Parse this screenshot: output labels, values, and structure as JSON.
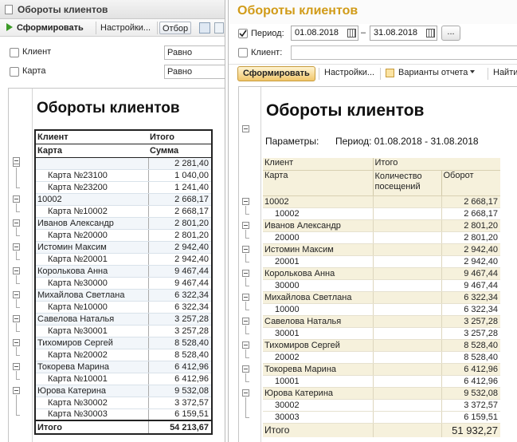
{
  "left": {
    "window_title": "Обороты клиентов",
    "toolbar": {
      "generate_label": "Сформировать",
      "settings_label": "Настройки...",
      "filter_label": "Отбор"
    },
    "filters": [
      {
        "label": "Клиент",
        "value": "Равно"
      },
      {
        "label": "Карта",
        "value": "Равно"
      }
    ],
    "report": {
      "title": "Обороты клиентов",
      "col_headers_1": [
        "Клиент",
        "Итого"
      ],
      "col_headers_2": [
        "Карта",
        "Сумма"
      ],
      "rows": [
        {
          "kind": "g",
          "name": "",
          "value": "2 281,40"
        },
        {
          "kind": "d",
          "name": "Карта №23100",
          "value": "1 040,00"
        },
        {
          "kind": "d",
          "name": "Карта №23200",
          "value": "1 241,40"
        },
        {
          "kind": "g",
          "name": "10002",
          "value": "2 668,17"
        },
        {
          "kind": "d",
          "name": "Карта №10002",
          "value": "2 668,17"
        },
        {
          "kind": "g",
          "name": "Иванов Александр",
          "value": "2 801,20"
        },
        {
          "kind": "d",
          "name": "Карта №20000",
          "value": "2 801,20"
        },
        {
          "kind": "g",
          "name": "Истомин Максим",
          "value": "2 942,40"
        },
        {
          "kind": "d",
          "name": "Карта №20001",
          "value": "2 942,40"
        },
        {
          "kind": "g",
          "name": "Королькова Анна",
          "value": "9 467,44"
        },
        {
          "kind": "d",
          "name": "Карта №30000",
          "value": "9 467,44"
        },
        {
          "kind": "g",
          "name": "Михайлова Светлана",
          "value": "6 322,34"
        },
        {
          "kind": "d",
          "name": "Карта №10000",
          "value": "6 322,34"
        },
        {
          "kind": "g",
          "name": "Савелова Наталья",
          "value": "3 257,28"
        },
        {
          "kind": "d",
          "name": "Карта №30001",
          "value": "3 257,28"
        },
        {
          "kind": "g",
          "name": "Тихомиров Сергей",
          "value": "8 528,40"
        },
        {
          "kind": "d",
          "name": "Карта №20002",
          "value": "8 528,40"
        },
        {
          "kind": "g",
          "name": "Токорева Марина",
          "value": "6 412,96"
        },
        {
          "kind": "d",
          "name": "Карта №10001",
          "value": "6 412,96"
        },
        {
          "kind": "g",
          "name": "Юрова Катерина",
          "value": "9 532,08"
        },
        {
          "kind": "d",
          "name": "Карта №30002",
          "value": "3 372,57"
        },
        {
          "kind": "d",
          "name": "Карта №30003",
          "value": "6 159,51"
        }
      ],
      "total": {
        "label": "Итого",
        "value": "54 213,67"
      }
    }
  },
  "right": {
    "title": "Обороты клиентов",
    "period": {
      "checked": true,
      "label": "Период:",
      "from": "01.08.2018",
      "separator": "–",
      "to": "31.08.2018",
      "more_label": "..."
    },
    "client_filter": {
      "checked": false,
      "label": "Клиент:",
      "value": ""
    },
    "toolbar": {
      "generate_label": "Сформировать",
      "settings_label": "Настройки...",
      "variants_label": "Варианты отчета",
      "find_label": "Найти..."
    },
    "report": {
      "title": "Обороты клиентов",
      "params_label": "Параметры:",
      "params_text": "Период: 01.08.2018 - 31.08.2018",
      "headers": {
        "client": "Клиент",
        "total": "Итого",
        "card": "Карта",
        "visits_line1": "Количество",
        "visits_line2": "посещений",
        "turnover": "Оборот"
      },
      "rows": [
        {
          "kind": "g",
          "name": "10002",
          "value": "2 668,17"
        },
        {
          "kind": "d",
          "name": "10002",
          "value": "2 668,17"
        },
        {
          "kind": "g",
          "name": "Иванов Александр",
          "value": "2 801,20"
        },
        {
          "kind": "d",
          "name": "20000",
          "value": "2 801,20"
        },
        {
          "kind": "g",
          "name": "Истомин Максим",
          "value": "2 942,40"
        },
        {
          "kind": "d",
          "name": "20001",
          "value": "2 942,40"
        },
        {
          "kind": "g",
          "name": "Королькова Анна",
          "value": "9 467,44"
        },
        {
          "kind": "d",
          "name": "30000",
          "value": "9 467,44"
        },
        {
          "kind": "g",
          "name": "Михайлова Светлана",
          "value": "6 322,34"
        },
        {
          "kind": "d",
          "name": "10000",
          "value": "6 322,34"
        },
        {
          "kind": "g",
          "name": "Савелова Наталья",
          "value": "3 257,28"
        },
        {
          "kind": "d",
          "name": "30001",
          "value": "3 257,28"
        },
        {
          "kind": "g",
          "name": "Тихомиров Сергей",
          "value": "8 528,40"
        },
        {
          "kind": "d",
          "name": "20002",
          "value": "8 528,40"
        },
        {
          "kind": "g",
          "name": "Токорева Марина",
          "value": "6 412,96"
        },
        {
          "kind": "d",
          "name": "10001",
          "value": "6 412,96"
        },
        {
          "kind": "g",
          "name": "Юрова Катерина",
          "value": "9 532,08"
        },
        {
          "kind": "d",
          "name": "30002",
          "value": "3 372,57"
        },
        {
          "kind": "d",
          "name": "30003",
          "value": "6 159,51"
        }
      ],
      "total": {
        "label": "Итого",
        "value": "51 932,27"
      }
    }
  }
}
